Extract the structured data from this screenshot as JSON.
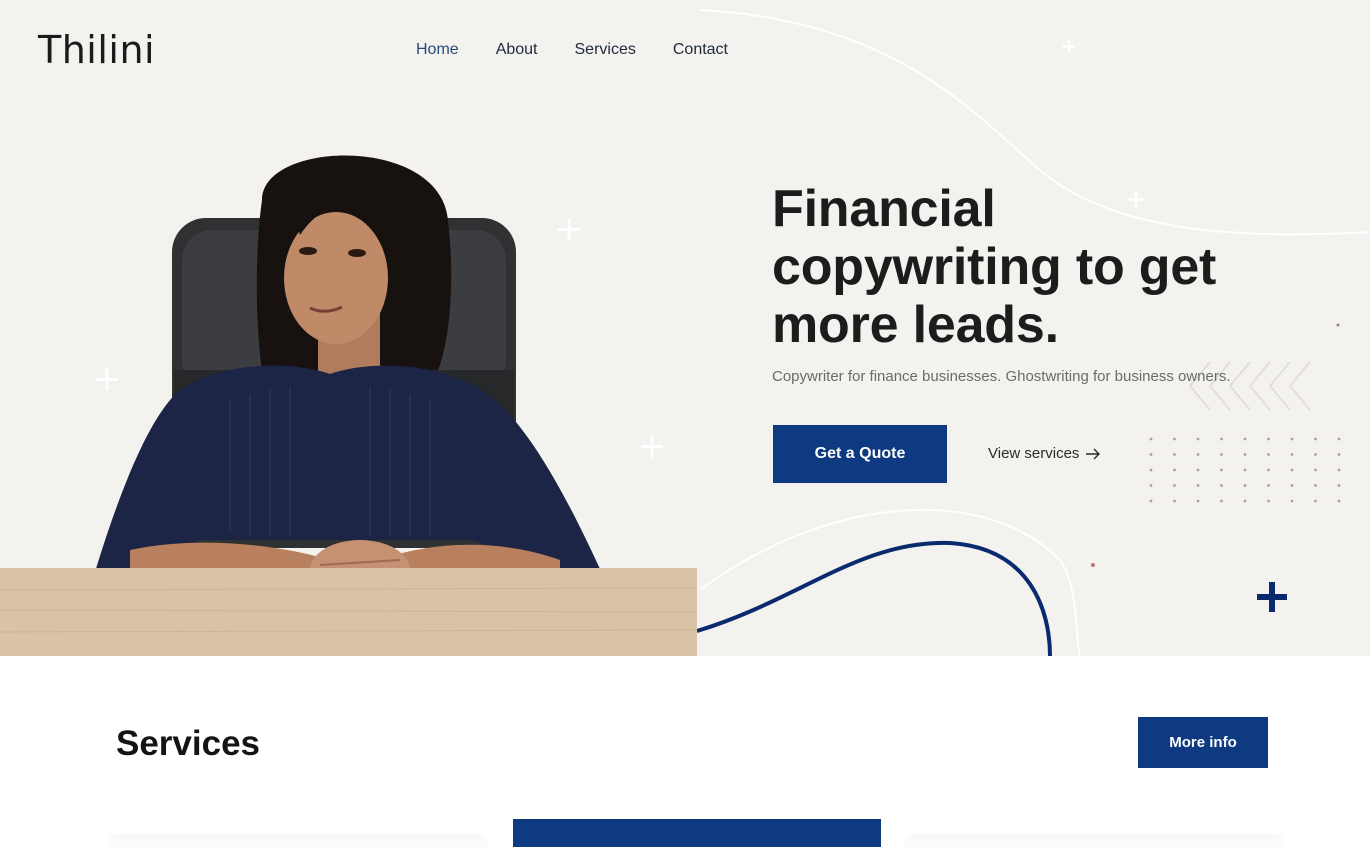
{
  "brand": {
    "logo_text": "Thilini"
  },
  "nav": {
    "items": [
      "Home",
      "About",
      "Services",
      "Contact"
    ],
    "active": "Home"
  },
  "hero": {
    "headline_lines": [
      "Financial",
      "copywriting to get",
      "more leads."
    ],
    "subline": "Copywriter for finance businesses. Ghostwriting for business owners.",
    "cta_primary": "Get a Quote",
    "cta_secondary": "View services",
    "cta_secondary_icon": "arrow-right-icon"
  },
  "services": {
    "title": "Services",
    "more_button": "More info"
  },
  "colors": {
    "accent": "#0d3a80",
    "hero_bg": "#f4f2ef",
    "page_bg": "#ffffff",
    "text": "#1c1c1c"
  }
}
